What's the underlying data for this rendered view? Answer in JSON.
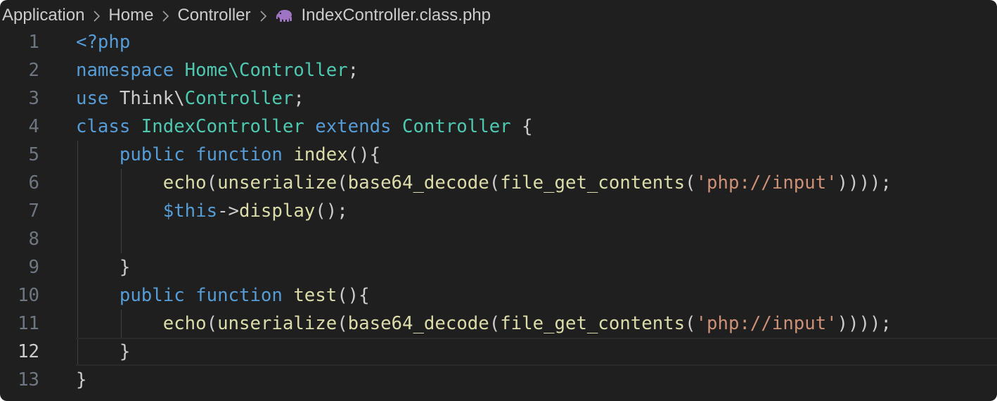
{
  "breadcrumb": {
    "items": [
      "Application",
      "Home",
      "Controller"
    ],
    "file": "IndexController.class.php",
    "file_icon": "php-elephant-icon"
  },
  "editor": {
    "current_line": 12,
    "colors": {
      "background": "#1f1f1f",
      "keyword": "#569cd6",
      "type": "#4ec9b0",
      "function": "#dcdcaa",
      "string": "#ce9178",
      "variable": "#9cdcfe",
      "text": "#cccccc",
      "line_number": "#6e7681"
    },
    "lines": [
      {
        "n": "1",
        "t": [
          {
            "c": "k",
            "v": "<?php"
          }
        ]
      },
      {
        "n": "2",
        "t": [
          {
            "c": "k",
            "v": "namespace"
          },
          {
            "c": "p",
            "v": " "
          },
          {
            "c": "ty",
            "v": "Home\\Controller"
          },
          {
            "c": "p",
            "v": ";"
          }
        ]
      },
      {
        "n": "3",
        "t": [
          {
            "c": "k",
            "v": "use"
          },
          {
            "c": "p",
            "v": " Think\\"
          },
          {
            "c": "ty",
            "v": "Controller"
          },
          {
            "c": "p",
            "v": ";"
          }
        ]
      },
      {
        "n": "4",
        "t": [
          {
            "c": "k",
            "v": "class"
          },
          {
            "c": "p",
            "v": " "
          },
          {
            "c": "ty",
            "v": "IndexController"
          },
          {
            "c": "p",
            "v": " "
          },
          {
            "c": "k",
            "v": "extends"
          },
          {
            "c": "p",
            "v": " "
          },
          {
            "c": "ty",
            "v": "Controller"
          },
          {
            "c": "p",
            "v": " {"
          }
        ]
      },
      {
        "n": "5",
        "t": [
          {
            "c": "p",
            "v": "    "
          },
          {
            "c": "k",
            "v": "public"
          },
          {
            "c": "p",
            "v": " "
          },
          {
            "c": "k",
            "v": "function"
          },
          {
            "c": "p",
            "v": " "
          },
          {
            "c": "fn",
            "v": "index"
          },
          {
            "c": "p",
            "v": "(){"
          }
        ]
      },
      {
        "n": "6",
        "t": [
          {
            "c": "p",
            "v": "        "
          },
          {
            "c": "fn",
            "v": "echo"
          },
          {
            "c": "p",
            "v": "("
          },
          {
            "c": "fn",
            "v": "unserialize"
          },
          {
            "c": "p",
            "v": "("
          },
          {
            "c": "fn",
            "v": "base64_decode"
          },
          {
            "c": "p",
            "v": "("
          },
          {
            "c": "fn",
            "v": "file_get_contents"
          },
          {
            "c": "p",
            "v": "("
          },
          {
            "c": "s",
            "v": "'php://input'"
          },
          {
            "c": "p",
            "v": "))));"
          }
        ]
      },
      {
        "n": "7",
        "t": [
          {
            "c": "p",
            "v": "        "
          },
          {
            "c": "k",
            "v": "$this"
          },
          {
            "c": "p",
            "v": "->"
          },
          {
            "c": "fn",
            "v": "display"
          },
          {
            "c": "p",
            "v": "();"
          }
        ]
      },
      {
        "n": "8",
        "t": [
          {
            "c": "p",
            "v": ""
          }
        ]
      },
      {
        "n": "9",
        "t": [
          {
            "c": "p",
            "v": "    }"
          }
        ]
      },
      {
        "n": "10",
        "t": [
          {
            "c": "p",
            "v": "    "
          },
          {
            "c": "k",
            "v": "public"
          },
          {
            "c": "p",
            "v": " "
          },
          {
            "c": "k",
            "v": "function"
          },
          {
            "c": "p",
            "v": " "
          },
          {
            "c": "fn",
            "v": "test"
          },
          {
            "c": "p",
            "v": "(){"
          }
        ]
      },
      {
        "n": "11",
        "t": [
          {
            "c": "p",
            "v": "        "
          },
          {
            "c": "fn",
            "v": "echo"
          },
          {
            "c": "p",
            "v": "("
          },
          {
            "c": "fn",
            "v": "unserialize"
          },
          {
            "c": "p",
            "v": "("
          },
          {
            "c": "fn",
            "v": "base64_decode"
          },
          {
            "c": "p",
            "v": "("
          },
          {
            "c": "fn",
            "v": "file_get_contents"
          },
          {
            "c": "p",
            "v": "("
          },
          {
            "c": "s",
            "v": "'php://input'"
          },
          {
            "c": "p",
            "v": "))));"
          }
        ]
      },
      {
        "n": "12",
        "t": [
          {
            "c": "p",
            "v": "    }"
          }
        ]
      },
      {
        "n": "13",
        "t": [
          {
            "c": "p",
            "v": "}"
          }
        ]
      }
    ]
  }
}
